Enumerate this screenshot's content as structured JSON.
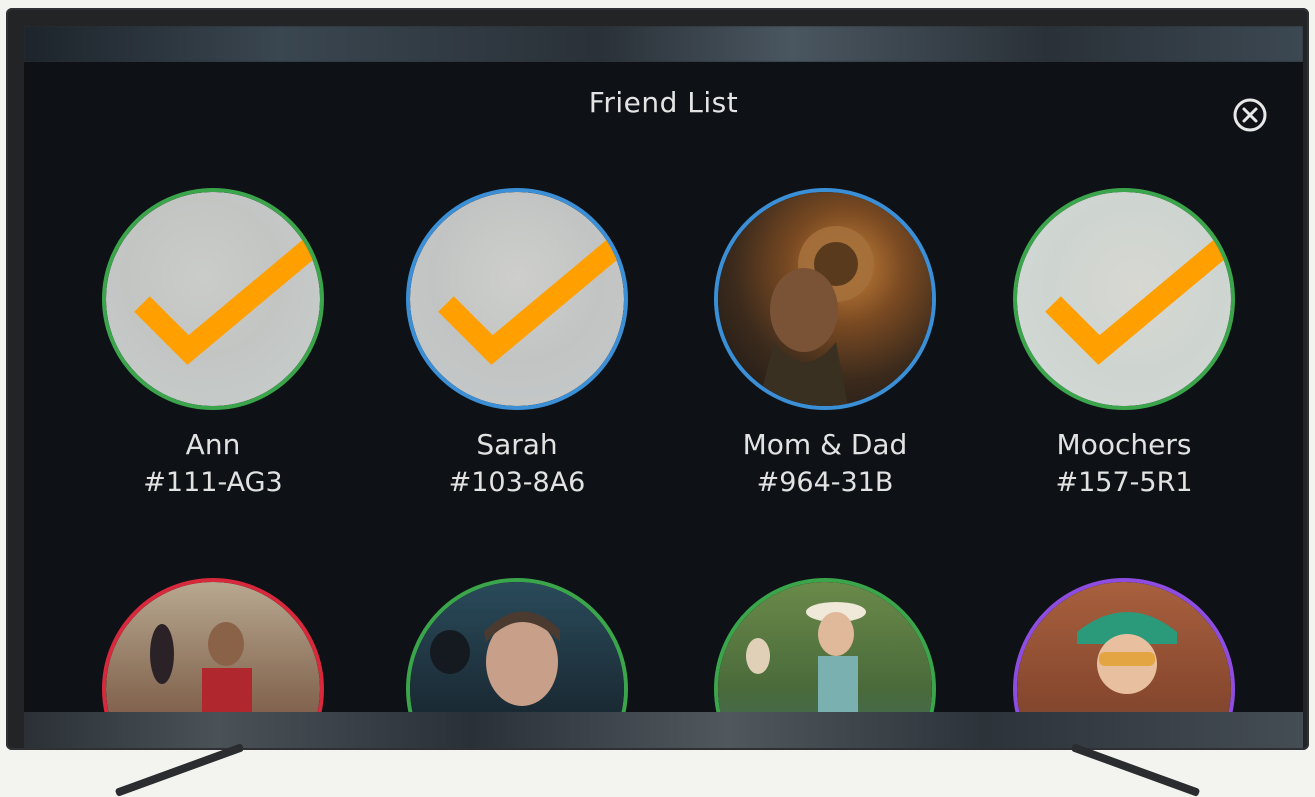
{
  "dialog": {
    "title": "Friend List",
    "close_icon": "close-circle-icon"
  },
  "friends": [
    {
      "name": "Ann",
      "code": "#111-AG3",
      "ring_color": "#3aa54a",
      "selected": true
    },
    {
      "name": "Sarah",
      "code": "#103-8A6",
      "ring_color": "#3a8fd6",
      "selected": true
    },
    {
      "name": "Mom & Dad",
      "code": "#964-31B",
      "ring_color": "#3a8fd6",
      "selected": false
    },
    {
      "name": "Moochers",
      "code": "#157-5R1",
      "ring_color": "#3aa54a",
      "selected": true
    },
    {
      "name": "",
      "code": "",
      "ring_color": "#d8283c",
      "selected": false
    },
    {
      "name": "",
      "code": "",
      "ring_color": "#3aa54a",
      "selected": false
    },
    {
      "name": "",
      "code": "",
      "ring_color": "#3aa54a",
      "selected": false
    },
    {
      "name": "",
      "code": "",
      "ring_color": "#8e4de0",
      "selected": false
    }
  ],
  "colors": {
    "check": "#ff9f00",
    "panel_bg": "#0e1216"
  }
}
